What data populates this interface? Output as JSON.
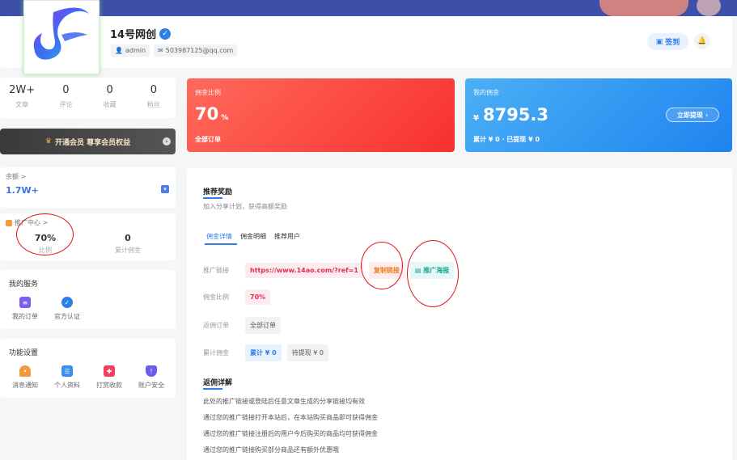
{
  "profile": {
    "name": "14号网创",
    "username": "admin",
    "email": "503987125@qq.com",
    "signin_label": "签到"
  },
  "stats": [
    {
      "value": "2W+",
      "label": "文章"
    },
    {
      "value": "0",
      "label": "评论"
    },
    {
      "value": "0",
      "label": "收藏"
    },
    {
      "value": "0",
      "label": "粉丝"
    }
  ],
  "vip": {
    "label": "开通会员 尊享会员权益"
  },
  "balance": {
    "title": "余额 >",
    "value": "1.7W+"
  },
  "promo_center": {
    "title": "推广中心 >",
    "ratio_value": "70%",
    "ratio_label": "比例",
    "total_value": "0",
    "total_label": "累计佣金"
  },
  "services": {
    "title": "我的服务",
    "items": [
      {
        "label": "我的订单",
        "icon": "order-icon"
      },
      {
        "label": "官方认证",
        "icon": "verified-icon"
      }
    ]
  },
  "settings": {
    "title": "功能设置",
    "items": [
      {
        "label": "消息通知",
        "icon": "bell-icon"
      },
      {
        "label": "个人资料",
        "icon": "profile-icon"
      },
      {
        "label": "打赏收款",
        "icon": "gift-icon"
      },
      {
        "label": "账户安全",
        "icon": "shield-icon"
      }
    ]
  },
  "rate_card": {
    "title": "佣金比例",
    "value": "70",
    "unit": "%",
    "sub": "全部订单",
    "color": "#f8302f"
  },
  "commission_card": {
    "title": "我的佣金",
    "currency": "¥",
    "value": "8795.3",
    "sub": "累计 ¥ 0 · 已提现 ¥ 0",
    "withdraw_label": "立即提现",
    "color": "#1f83ef"
  },
  "referral": {
    "title": "推荐奖励",
    "subtitle": "加入分享计划，获得高额奖励",
    "tabs": [
      "佣金详情",
      "佣金明细",
      "推荐用户"
    ],
    "rows": {
      "link_label": "推广链接",
      "link_value": "https://www.14ao.com/?ref=1",
      "copy_label": "复制链接",
      "poster_label": "推广海报",
      "rate_label": "佣金比例",
      "rate_value": "70%",
      "orders_label": "返佣订单",
      "orders_value": "全部订单",
      "total_label": "累计佣金",
      "total_value": "累计 ¥ 0",
      "pending_value": "待提现 ¥ 0"
    },
    "details_title": "返佣详解",
    "details": [
      "此处的推广链接或登陆后任意文章生成的分享链接均有效",
      "通过您的推广链接打开本站后，在本站购买商品即可获得佣金",
      "通过您的推广链接注册后的用户今后购买的商品均可获得佣金",
      "通过您的推广链接购买部分商品还有额外优惠哦"
    ]
  }
}
